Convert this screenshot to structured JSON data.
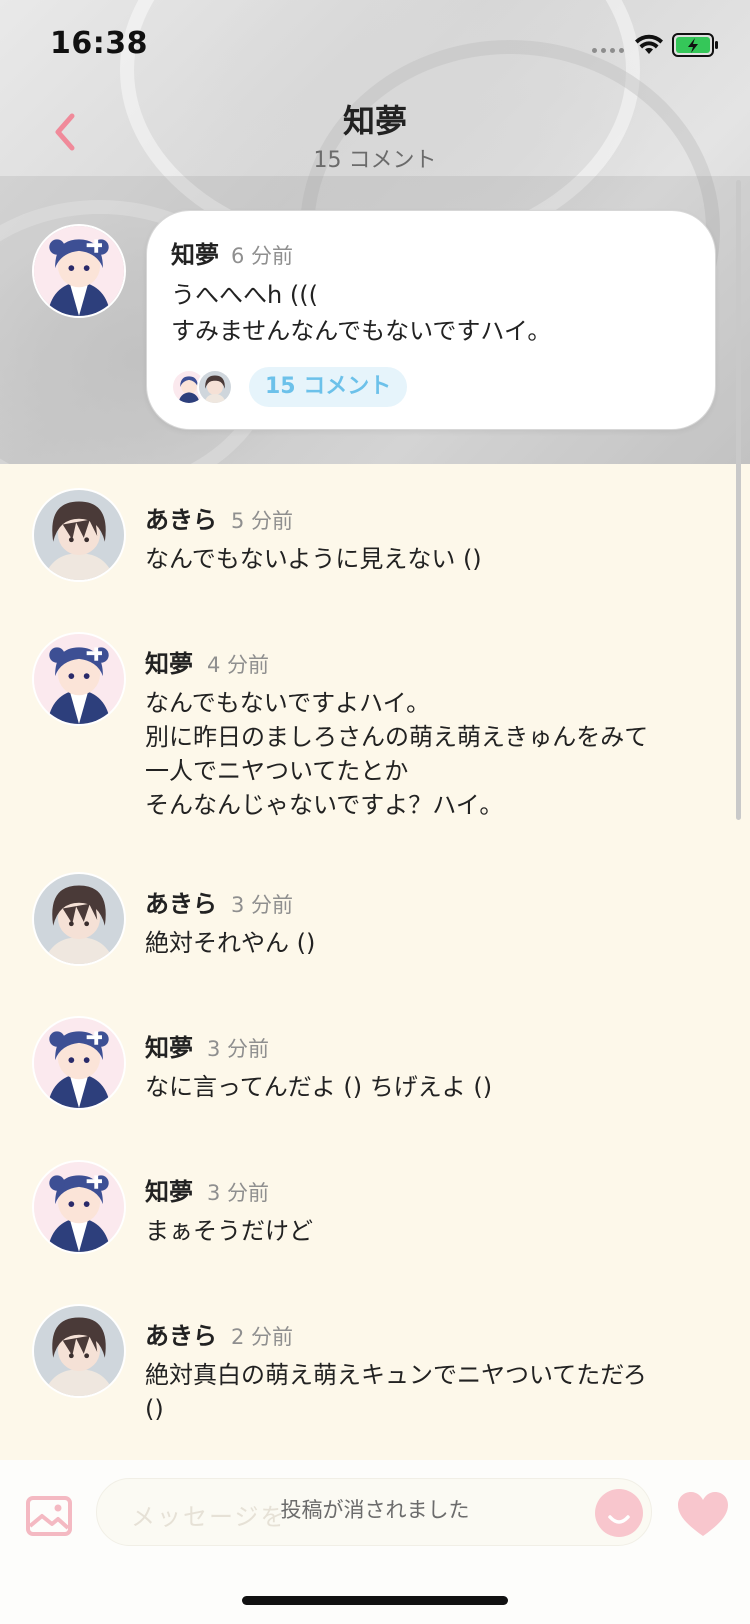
{
  "status": {
    "time": "16:38"
  },
  "nav": {
    "title": "知夢",
    "subtitle": "15 コメント"
  },
  "post": {
    "author": "知夢",
    "time_ago": "6 分前",
    "text": "うへへへh (((\nすみませんなんでもないですハイ。",
    "comment_count_label": "15 コメント"
  },
  "comments": [
    {
      "author": "あきら",
      "time_ago": "5 分前",
      "text": "なんでもないように見えない ()",
      "avatar": "akira"
    },
    {
      "author": "知夢",
      "time_ago": "4 分前",
      "text": "なんでもないですよハイ。\n別に昨日のましろさんの萌え萌えきゅんをみて\n一人でニヤついてたとか\nそんなんじゃないですよ？ハイ。",
      "avatar": "chimu"
    },
    {
      "author": "あきら",
      "time_ago": "3 分前",
      "text": "絶対それやん ()",
      "avatar": "akira"
    },
    {
      "author": "知夢",
      "time_ago": "3 分前",
      "text": "なに言ってんだよ () ちげえよ ()",
      "avatar": "chimu"
    },
    {
      "author": "知夢",
      "time_ago": "3 分前",
      "text": "まぁそうだけど",
      "avatar": "chimu"
    },
    {
      "author": "あきら",
      "time_ago": "2 分前",
      "text": "絶対真白の萌え萌えキュンでニヤついてただろ\n()",
      "avatar": "akira"
    }
  ],
  "composer": {
    "placeholder": "メッセージを",
    "toast": "投稿が消されました"
  },
  "colors": {
    "accent_pink": "#f08a9a",
    "pill_blue": "#6cc1ea",
    "battery_green": "#35c759",
    "background": "#fdf8ea"
  },
  "icons": {
    "back": "chevron-left-icon",
    "image": "image-icon",
    "emoji": "emoji-icon",
    "heart": "heart-icon"
  }
}
